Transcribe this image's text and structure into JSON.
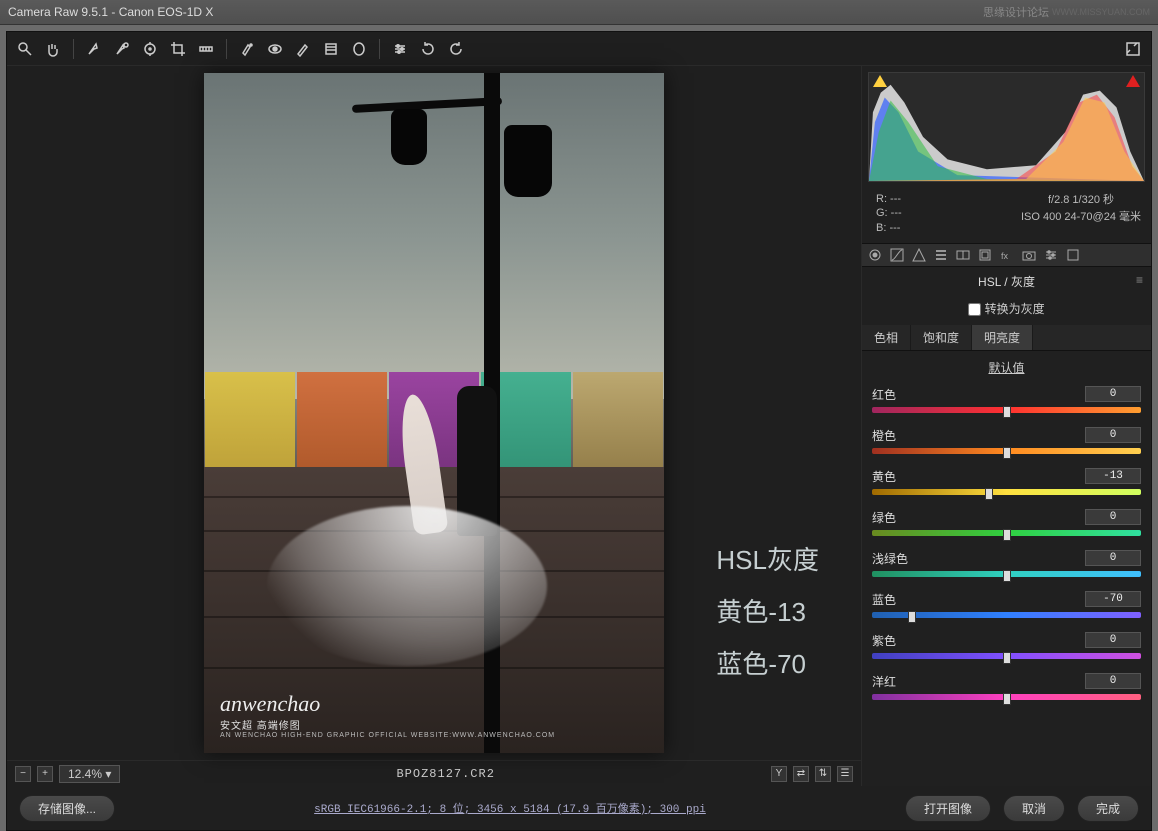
{
  "window": {
    "title": "Camera Raw 9.5.1  -  Canon EOS-1D X",
    "top_watermark": "思缘设计论坛",
    "top_watermark_url": "WWW.MISSYUAN.COM"
  },
  "tools": [
    "zoom",
    "hand",
    "eyedrop",
    "sampler",
    "target",
    "crop",
    "straighten",
    "spot",
    "redeye",
    "brush",
    "grad",
    "radial",
    "tone",
    "rotate-ccw",
    "rotate-cw"
  ],
  "preview": {
    "zoom_minus": "−",
    "zoom_plus": "+",
    "zoom": "12.4%",
    "filename": "BPOZ8127.CR2",
    "photo_watermark_main": "anwenchao",
    "photo_watermark_sub": "安文超 高端修图",
    "photo_watermark_sub2": "AN WENCHAO HIGH-END GRAPHIC  OFFICIAL WEBSITE:WWW.ANWENCHAO.COM"
  },
  "overlay": {
    "line1": "HSL灰度",
    "line2": "黄色-13",
    "line3": "蓝色-70"
  },
  "exif": {
    "r": "R:   ---",
    "g": "G:   ---",
    "b": "B:   ---",
    "line1": "f/2.8  1/320 秒",
    "line2": "ISO 400  24-70@24 毫米"
  },
  "panel": {
    "title": "HSL / 灰度",
    "convert_label": "转换为灰度",
    "convert_checked": false,
    "subtabs": {
      "hue": "色相",
      "sat": "饱和度",
      "lum": "明亮度"
    },
    "active_subtab": "lum",
    "default_link": "默认值"
  },
  "sliders": [
    {
      "id": "red",
      "label": "红色",
      "value": 0,
      "gradient": "linear-gradient(90deg,#a0265f,#ff3030,#ff9e30)"
    },
    {
      "id": "orange",
      "label": "橙色",
      "value": 0,
      "gradient": "linear-gradient(90deg,#a03020,#ff8a20,#ffd050)"
    },
    {
      "id": "yellow",
      "label": "黄色",
      "value": -13,
      "gradient": "linear-gradient(90deg,#a06a00,#ffe040,#d0ff60)"
    },
    {
      "id": "green",
      "label": "绿色",
      "value": 0,
      "gradient": "linear-gradient(90deg,#6a8a20,#30d040,#30e0a0)"
    },
    {
      "id": "aqua",
      "label": "浅绿色",
      "value": 0,
      "gradient": "linear-gradient(90deg,#209060,#30d0c0,#40c0ff)"
    },
    {
      "id": "blue",
      "label": "蓝色",
      "value": -70,
      "gradient": "linear-gradient(90deg,#2060b0,#3080ff,#8060ff)"
    },
    {
      "id": "purple",
      "label": "紫色",
      "value": 0,
      "gradient": "linear-gradient(90deg,#4040c0,#8050ff,#d050e0)"
    },
    {
      "id": "magenta",
      "label": "洋红",
      "value": 0,
      "gradient": "linear-gradient(90deg,#8030a0,#ff40c0,#ff6080)"
    }
  ],
  "buttons": {
    "save": "存储图像...",
    "open": "打开图像",
    "cancel": "取消",
    "done": "完成"
  },
  "info_link": "sRGB IEC61966-2.1; 8 位;  3456 x 5184 (17.9 百万像素); 300 ppi"
}
